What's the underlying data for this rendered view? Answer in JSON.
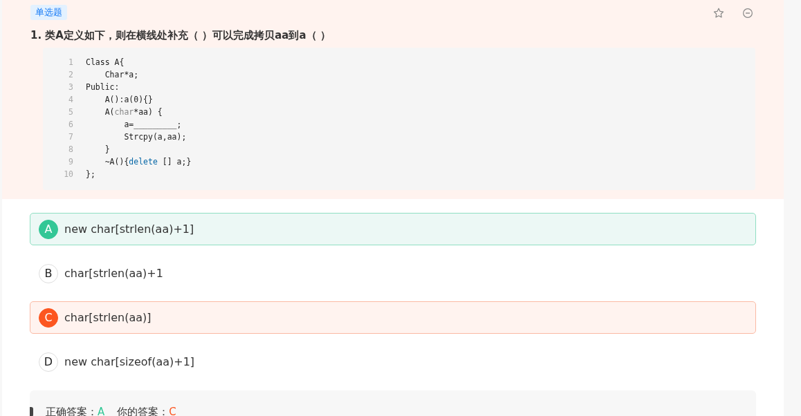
{
  "question": {
    "type_tag": "单选题",
    "title": "1. 类A定义如下，则在横线处补充（      ）可以完成拷贝aa到a（      ）",
    "code": [
      {
        "number": "1",
        "segments": [
          {
            "kind": "plain",
            "text": "Class A{"
          }
        ]
      },
      {
        "number": "2",
        "segments": [
          {
            "kind": "plain",
            "text": "    Char*a;"
          }
        ]
      },
      {
        "number": "3",
        "segments": [
          {
            "kind": "plain",
            "text": "Public:"
          }
        ]
      },
      {
        "number": "4",
        "segments": [
          {
            "kind": "plain",
            "text": "    A():a(0){}"
          }
        ]
      },
      {
        "number": "5",
        "segments": [
          {
            "kind": "plain",
            "text": "    A("
          },
          {
            "kind": "type",
            "text": "char"
          },
          {
            "kind": "plain",
            "text": "*aa) {"
          }
        ]
      },
      {
        "number": "6",
        "segments": [
          {
            "kind": "plain",
            "text": "        a=_________;"
          }
        ]
      },
      {
        "number": "7",
        "segments": [
          {
            "kind": "plain",
            "text": "        Strcpy(a,aa);"
          }
        ]
      },
      {
        "number": "8",
        "segments": [
          {
            "kind": "plain",
            "text": "    }"
          }
        ]
      },
      {
        "number": "9",
        "segments": [
          {
            "kind": "plain",
            "text": "    ~A(){"
          },
          {
            "kind": "keyword",
            "text": "delete"
          },
          {
            "kind": "plain",
            "text": " [] a;}"
          }
        ]
      },
      {
        "number": "10",
        "segments": [
          {
            "kind": "plain",
            "text": "};"
          }
        ]
      }
    ]
  },
  "options": [
    {
      "letter": "A",
      "text": "new char[strlen(aa)+1]",
      "correct": true,
      "selected": false
    },
    {
      "letter": "B",
      "text": "char[strlen(aa)+1",
      "correct": false,
      "selected": false
    },
    {
      "letter": "C",
      "text": "char[strlen(aa)]",
      "correct": false,
      "selected": true
    },
    {
      "letter": "D",
      "text": "new char[sizeof(aa)+1]",
      "correct": false,
      "selected": false
    }
  ],
  "answer": {
    "correct_label": "正确答案：",
    "correct": "A",
    "yours_label": "你的答案：",
    "yours": "C"
  }
}
